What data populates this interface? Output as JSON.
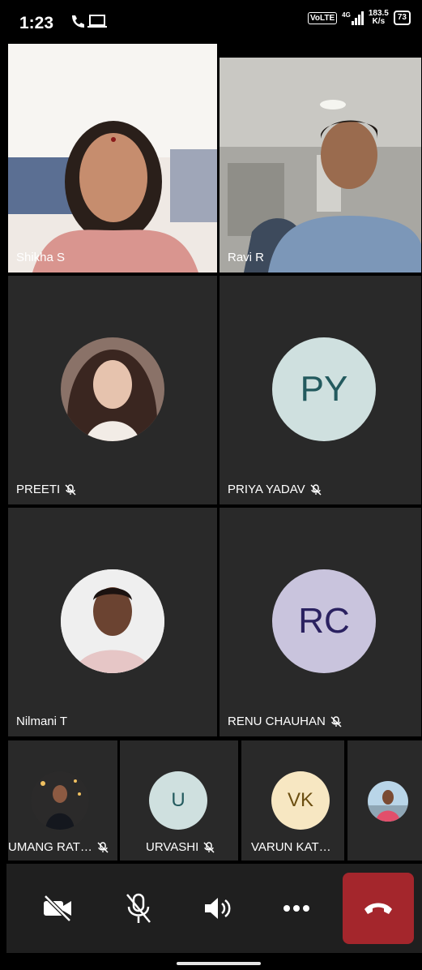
{
  "status_bar": {
    "time": "1:23",
    "volte": "VoLTE",
    "network": "4G",
    "speed_value": "183.5",
    "speed_unit": "K/s",
    "battery": "73"
  },
  "tiles": {
    "shikha": {
      "name": "Shikha S"
    },
    "ravi": {
      "name": "Ravi R"
    },
    "preeti": {
      "name": "PREETI",
      "muted": true
    },
    "priya": {
      "name": "PRIYA YADAV",
      "initials": "PY",
      "avatar_color": "#cfe0df",
      "initials_color": "#235a5e",
      "muted": true
    },
    "nilmani": {
      "name": "Nilmani T"
    },
    "renu": {
      "name": "RENU CHAUHAN",
      "initials": "RC",
      "avatar_color": "#c9c4dd",
      "initials_color": "#2a2160",
      "muted": true
    }
  },
  "bottom_row": [
    {
      "name": "UMANG RAT…",
      "muted": true
    },
    {
      "name": "URVASHI",
      "initials": "U",
      "avatar_color": "#cfe0df",
      "initials_color": "#235a5e",
      "muted": true
    },
    {
      "name": "VARUN KAT…",
      "initials": "VK",
      "avatar_color": "#f7e7c2",
      "initials_color": "#6b4e10"
    }
  ],
  "controls": {
    "camera": "camera-off",
    "mic": "mic-off",
    "speaker": "speaker",
    "more": "more",
    "end_call": "end-call",
    "end_call_color": "#a4262c"
  }
}
